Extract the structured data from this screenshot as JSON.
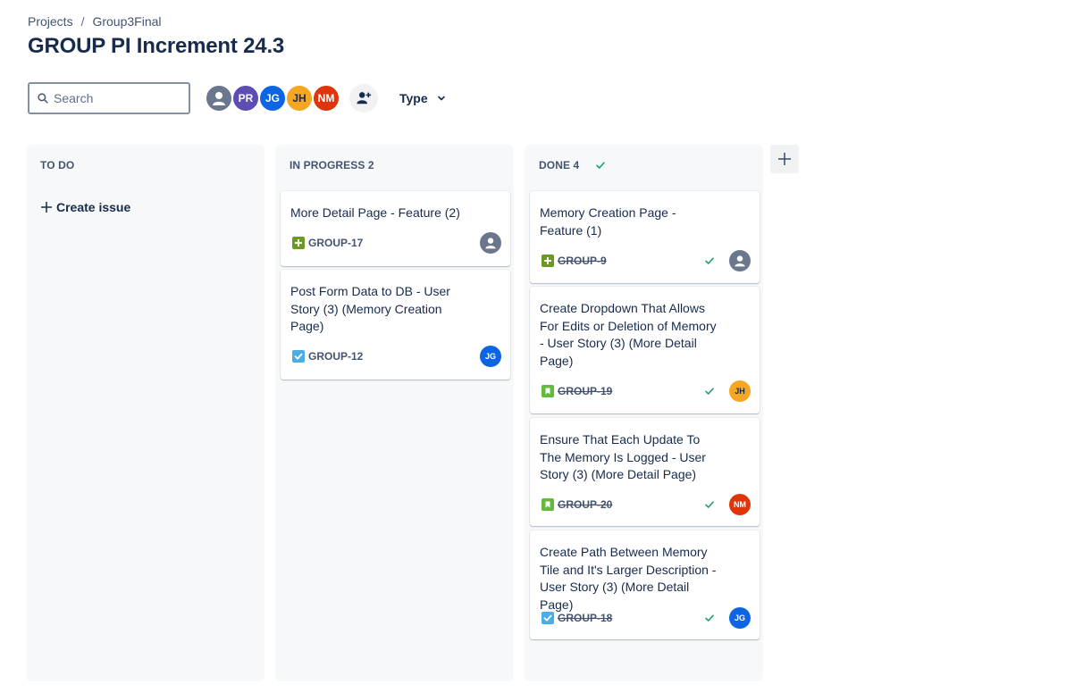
{
  "breadcrumb": {
    "projects": "Projects",
    "separator": "/",
    "project": "Group3Final"
  },
  "page_title": "GROUP PI Increment 24.3",
  "search": {
    "placeholder": "Search",
    "value": ""
  },
  "avatars": [
    {
      "initials": "",
      "color": "#6b778c"
    },
    {
      "initials": "PR",
      "color": "#5e4db2"
    },
    {
      "initials": "JG",
      "color": "#0c66e4"
    },
    {
      "initials": "JH",
      "color": "#f5a623"
    },
    {
      "initials": "NM",
      "color": "#de350b"
    }
  ],
  "filters": {
    "type_label": "Type"
  },
  "columns": {
    "todo": {
      "title": "TO DO",
      "create_label": "Create issue"
    },
    "progress": {
      "title": "IN PROGRESS 2",
      "cards": [
        {
          "title": "More Detail Page - Feature (2)",
          "key": "GROUP-17",
          "type_icon": "feature-icon",
          "assignee": ""
        },
        {
          "title": "Post Form Data to DB - User Story (3) (Memory Creation Page)",
          "key": "GROUP-12",
          "type_icon": "task-icon",
          "assignee": "JG"
        }
      ]
    },
    "done": {
      "title": "DONE 4",
      "cards": [
        {
          "title": "Memory Creation Page - Feature (1)",
          "key": "GROUP-9",
          "type_icon": "feature-icon",
          "assignee": ""
        },
        {
          "title": "Create Dropdown That Allows For Edits or Deletion of Memory - User Story (3) (More Detail Page)",
          "key": "GROUP-19",
          "type_icon": "story-icon",
          "assignee": "JH"
        },
        {
          "title": "Ensure That Each Update To The Memory Is Logged - User Story (3) (More Detail Page)",
          "key": "GROUP-20",
          "type_icon": "story-icon",
          "assignee": "NM"
        },
        {
          "title": "Create Path Between Memory Tile and It's Larger Description - User Story (3) (More Detail Page)",
          "key": "GROUP-18",
          "type_icon": "task-icon",
          "assignee": "JG"
        }
      ]
    }
  },
  "colors": {
    "feature": "#6a9a23",
    "story": "#63ba3c",
    "task": "#4bade8",
    "done_check": "#22a06b"
  }
}
